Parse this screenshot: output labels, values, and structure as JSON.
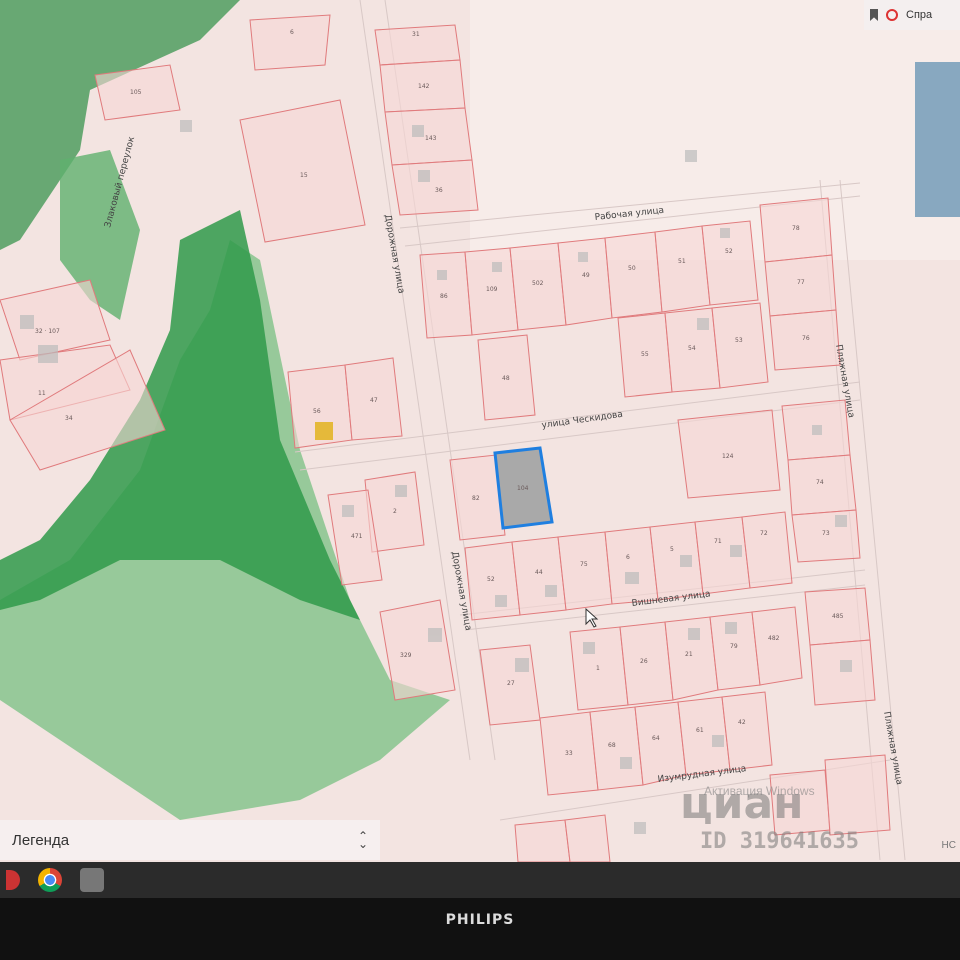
{
  "topbar": {
    "bookmark_icon": "bookmark-icon",
    "help_label": "Спра"
  },
  "legend": {
    "label": "Легенда"
  },
  "map": {
    "streets": [
      {
        "id": "rabochaya",
        "label": "Рабочая улица"
      },
      {
        "id": "dorozhnaya-top",
        "label": "Дорожная улица"
      },
      {
        "id": "dorozhnaya-bottom",
        "label": "Дорожная улица"
      },
      {
        "id": "cheskidova",
        "label": "улица Ческидова"
      },
      {
        "id": "vishnevaya",
        "label": "Вишневая улица"
      },
      {
        "id": "zlakovy",
        "label": "Злаковый переулок"
      },
      {
        "id": "izumrudnaya",
        "label": "Изумрудная улица"
      },
      {
        "id": "plyazhnaya-top",
        "label": "Пляжная улица"
      },
      {
        "id": "plyazhnaya-bottom",
        "label": "Пляжная улица"
      }
    ],
    "parcels": [
      {
        "id": "p-31",
        "label": "31"
      },
      {
        "id": "p-142",
        "label": "142"
      },
      {
        "id": "p-143",
        "label": "143"
      },
      {
        "id": "p-36",
        "label": "36"
      },
      {
        "id": "p-105",
        "label": "105"
      },
      {
        "id": "p-6",
        "label": "6"
      },
      {
        "id": "p-15",
        "label": "15"
      },
      {
        "id": "p-32-107",
        "label": "32 · 107"
      },
      {
        "id": "p-11",
        "label": "11"
      },
      {
        "id": "p-34",
        "label": "34"
      },
      {
        "id": "p-86",
        "label": "86"
      },
      {
        "id": "p-109",
        "label": "109"
      },
      {
        "id": "p-502",
        "label": "502"
      },
      {
        "id": "p-49",
        "label": "49"
      },
      {
        "id": "p-50",
        "label": "50"
      },
      {
        "id": "p-51",
        "label": "51"
      },
      {
        "id": "p-52",
        "label": "52"
      },
      {
        "id": "p-78",
        "label": "78"
      },
      {
        "id": "p-77",
        "label": "77"
      },
      {
        "id": "p-76",
        "label": "76"
      },
      {
        "id": "p-55",
        "label": "55"
      },
      {
        "id": "p-54",
        "label": "54"
      },
      {
        "id": "p-53",
        "label": "53"
      },
      {
        "id": "p-48",
        "label": "48"
      },
      {
        "id": "p-56",
        "label": "56"
      },
      {
        "id": "p-47",
        "label": "47"
      },
      {
        "id": "p-82",
        "label": "82"
      },
      {
        "id": "p-104",
        "label": "104"
      },
      {
        "id": "p-124",
        "label": "124"
      },
      {
        "id": "p-74",
        "label": "74"
      },
      {
        "id": "p-73",
        "label": "73"
      },
      {
        "id": "p-2",
        "label": "2"
      },
      {
        "id": "p-471",
        "label": "471"
      },
      {
        "id": "p-52b",
        "label": "52"
      },
      {
        "id": "p-44",
        "label": "44"
      },
      {
        "id": "p-75",
        "label": "75"
      },
      {
        "id": "p-6b",
        "label": "6"
      },
      {
        "id": "p-5",
        "label": "5"
      },
      {
        "id": "p-71",
        "label": "71"
      },
      {
        "id": "p-72",
        "label": "72"
      },
      {
        "id": "p-329",
        "label": "329"
      },
      {
        "id": "p-27",
        "label": "27"
      },
      {
        "id": "p-1",
        "label": "1"
      },
      {
        "id": "p-26",
        "label": "26"
      },
      {
        "id": "p-21",
        "label": "21"
      },
      {
        "id": "p-79",
        "label": "79"
      },
      {
        "id": "p-482",
        "label": "482"
      },
      {
        "id": "p-485",
        "label": "485"
      },
      {
        "id": "p-33",
        "label": "33"
      },
      {
        "id": "p-68",
        "label": "68"
      },
      {
        "id": "p-64",
        "label": "64"
      },
      {
        "id": "p-61",
        "label": "61"
      },
      {
        "id": "p-42",
        "label": "42"
      }
    ],
    "selected_parcel": "104",
    "colors": {
      "parcel_fill": "#f6d7d6",
      "parcel_stroke": "#e07a7c",
      "forest_dark": "#43a35a",
      "forest_light": "#6cbf7a",
      "selected_stroke": "#1f7fe0",
      "selected_fill": "#a9a9a9",
      "background": "#f2e3e0"
    }
  },
  "overlay": {
    "activation": "Активация Windows",
    "brand": "циан",
    "listing_id": "ID 319641635",
    "corner": "НС"
  },
  "monitor": {
    "brand": "PHILIPS"
  },
  "taskbar": {
    "icons": [
      "chrome-icon",
      "image-viewer-icon"
    ]
  }
}
